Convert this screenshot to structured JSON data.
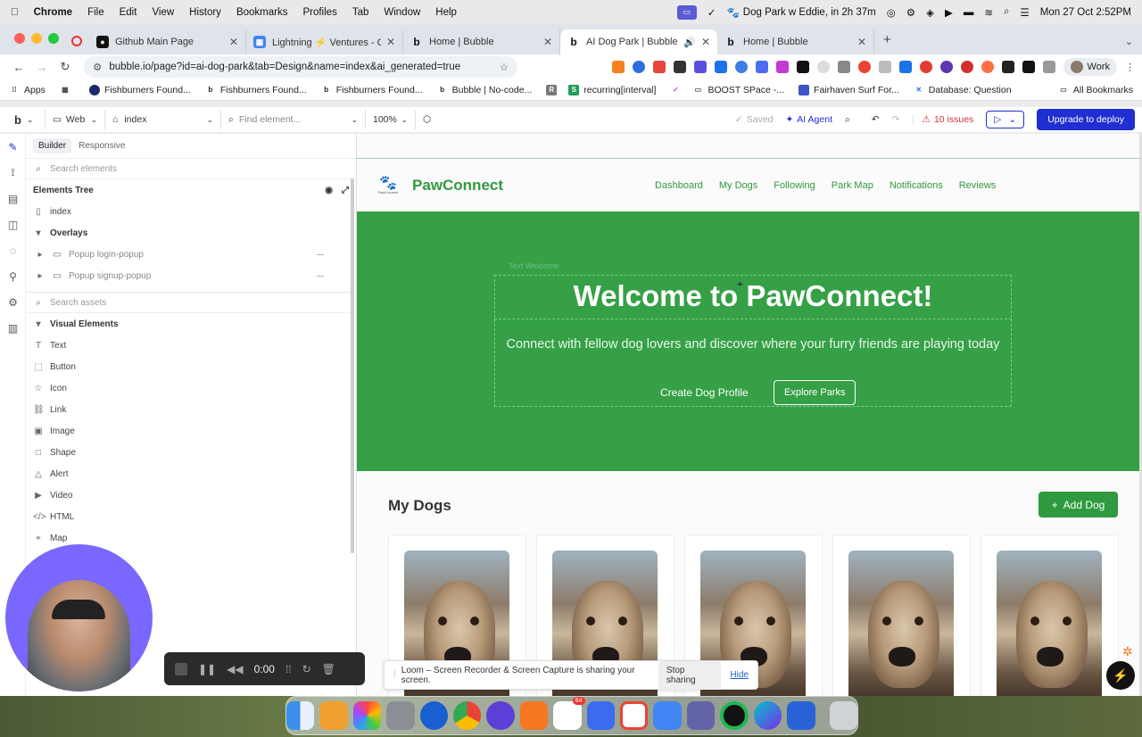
{
  "menubar": {
    "app": "Chrome",
    "items": [
      "File",
      "Edit",
      "View",
      "History",
      "Bookmarks",
      "Profiles",
      "Tab",
      "Window",
      "Help"
    ],
    "event": "Dog Park w Eddie, in 2h 37m",
    "datetime": "Mon 27 Oct  2:52PM"
  },
  "tabs": [
    {
      "title": "Github Main Page",
      "active": false
    },
    {
      "title": "Lightning ⚡ Ventures - Cale",
      "active": false
    },
    {
      "title": "Home | Bubble",
      "active": false
    },
    {
      "title": "AI Dog Park | Bubble Edito",
      "active": true
    },
    {
      "title": "Home | Bubble",
      "active": false
    }
  ],
  "address": {
    "url": "bubble.io/page?id=ai-dog-park&tab=Design&name=index&ai_generated=true",
    "profile": "Work"
  },
  "bookmarks": {
    "apps": "Apps",
    "items": [
      "Fishburners Found...",
      "Fishburners Found...",
      "Fishburners Found...",
      "Bubble | No-code...",
      "",
      "recurring[interval]",
      "",
      "BOOST SPace -...",
      "Fairhaven Surf For...",
      "Database: Question"
    ],
    "all": "All Bookmarks"
  },
  "bubble_toolbar": {
    "platform": "Web",
    "page": "index",
    "find_placeholder": "Find element...",
    "zoom": "100%",
    "saved": "Saved",
    "ai_agent": "AI Agent",
    "issues": "10 issues",
    "deploy": "Upgrade to deploy"
  },
  "left_panel": {
    "tab_builder": "Builder",
    "tab_responsive": "Responsive",
    "search_elements": "Search elements",
    "elements_tree": "Elements Tree",
    "tree": {
      "index": "index",
      "overlays": "Overlays",
      "popup_login": "Popup login-popup",
      "popup_signup": "Popup signup-popup"
    },
    "search_assets": "Search assets",
    "visual_elements": "Visual Elements",
    "elements": [
      "Text",
      "Button",
      "Icon",
      "Link",
      "Image",
      "Shape",
      "Alert",
      "Video",
      "HTML",
      "Map"
    ]
  },
  "app_page": {
    "brand": "PawConnect",
    "nav": [
      "Dashboard",
      "My Dogs",
      "Following",
      "Park Map",
      "Notifications",
      "Reviews"
    ],
    "hero_group_label": "Text Welcome",
    "hero_title": "Welcome to PawConnect!",
    "hero_subtitle": "Connect with fellow dog lovers and discover where your furry friends are playing today",
    "btn_create": "Create Dog Profile",
    "btn_explore": "Explore Parks",
    "section_title": "My Dogs",
    "add_dog": "Add Dog",
    "dog_card_count": 5
  },
  "recorder": {
    "time": "0:00"
  },
  "loom": {
    "message": "Loom – Screen Recorder & Screen Capture is sharing your screen.",
    "stop": "Stop sharing",
    "hide": "Hide"
  },
  "dock": {
    "slack_badge": "64"
  },
  "colors": {
    "bubble_blue": "#1f2fd1",
    "hero_green": "#35a046",
    "brand_green": "#2f9a3f",
    "issues_red": "#d33"
  }
}
